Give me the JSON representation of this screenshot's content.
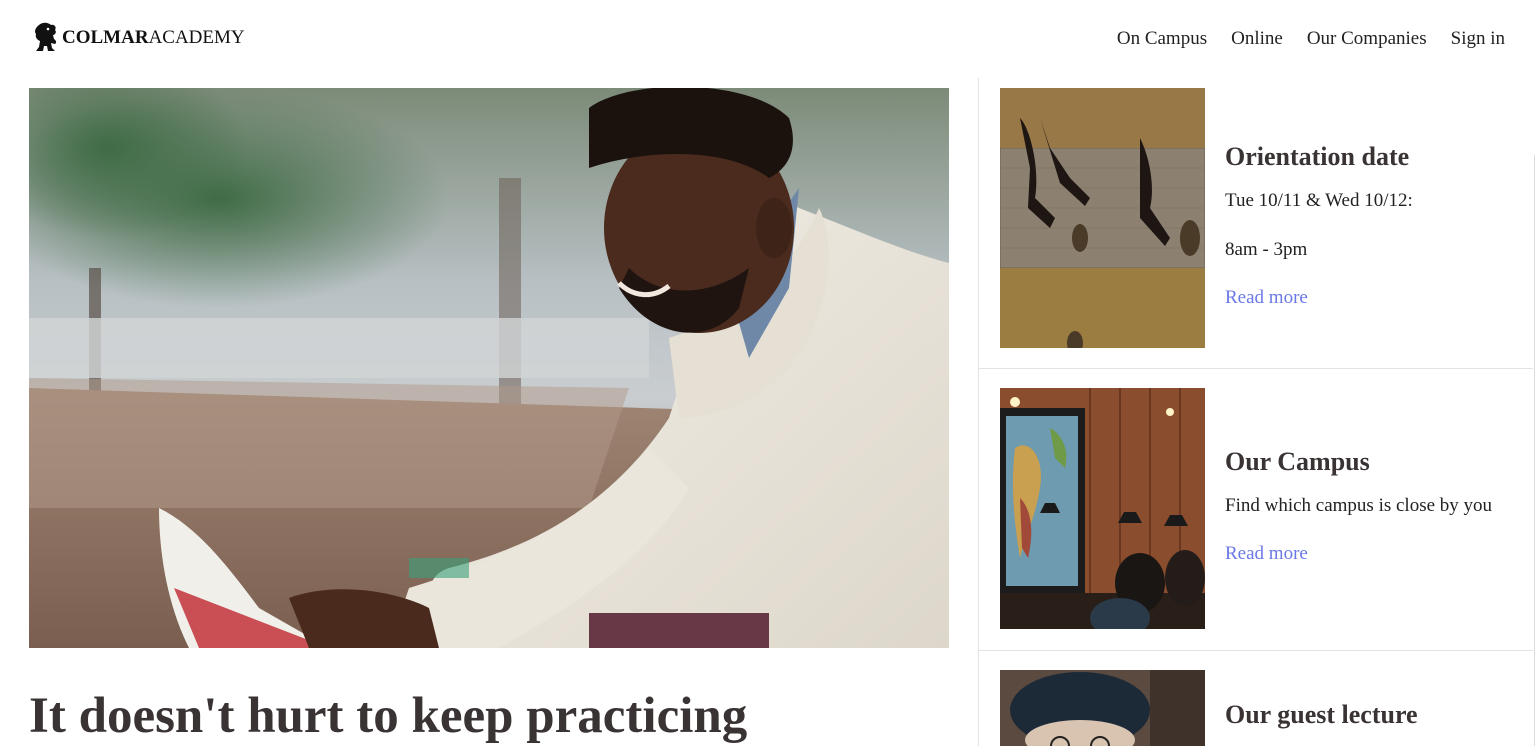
{
  "header": {
    "logo_bold": "COLMAR",
    "logo_regular": "ACADEMY",
    "logo_icon": "lion-icon",
    "nav": [
      "On Campus",
      "Online",
      "Our Companies",
      "Sign in"
    ]
  },
  "hero": {
    "image": "man-reading-book-photo",
    "headline": "It doesn't hurt to keep practicing"
  },
  "sidebar": {
    "cards": [
      {
        "image": "people-shadows-photo",
        "title": "Orientation date",
        "lines": [
          "Tue 10/11 & Wed 10/12:",
          "8am - 3pm"
        ],
        "link": "Read more"
      },
      {
        "image": "campus-cafe-photo",
        "title": "Our Campus",
        "lines": [
          "Find which campus is close by you"
        ],
        "link": "Read more"
      },
      {
        "image": "guest-lecturer-photo",
        "title": "Our guest lecture",
        "lines": [],
        "link": ""
      }
    ]
  },
  "colors": {
    "link": "#6a78e6",
    "heading": "#3a3333",
    "divider": "#e3e3e3"
  }
}
